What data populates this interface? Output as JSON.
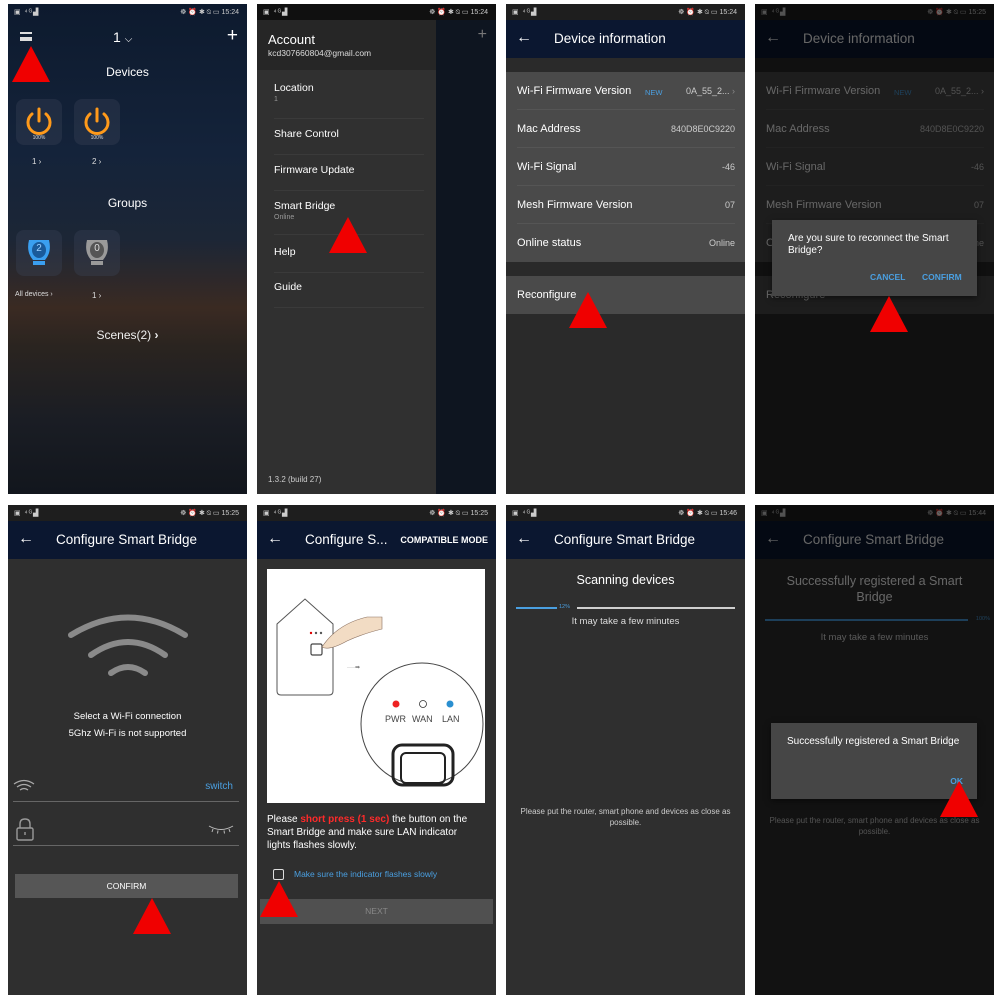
{
  "status_bar": {
    "left_icons": "▣ ⁴ᴳ▟",
    "right_icons": "☸ ⏰ ✱ ⍉ ▭",
    "times": [
      "15:24",
      "15:24",
      "15:24",
      "15:25",
      "15:25",
      "15:25",
      "15:46",
      "15:44"
    ]
  },
  "screen1": {
    "location_selector": "1",
    "devices_heading": "Devices",
    "devices": [
      {
        "label": "1",
        "brightness": "100%"
      },
      {
        "label": "2",
        "brightness": "100%"
      }
    ],
    "groups_heading": "Groups",
    "groups": [
      {
        "label": "All devices",
        "count": "2"
      },
      {
        "label": "1",
        "count": "0"
      }
    ],
    "scenes_link": "Scenes(2)"
  },
  "screen2": {
    "account_title": "Account",
    "account_email": "kcd307660804@gmail.com",
    "menu": [
      {
        "label": "Location",
        "sub": "1"
      },
      {
        "label": "Share Control",
        "sub": ""
      },
      {
        "label": "Firmware Update",
        "sub": ""
      },
      {
        "label": "Smart Bridge",
        "sub": "Online"
      },
      {
        "label": "Help",
        "sub": ""
      },
      {
        "label": "Guide",
        "sub": ""
      }
    ],
    "version": "1.3.2 (build 27)"
  },
  "device_info": {
    "title": "Device information",
    "rows": [
      {
        "key": "Wi-Fi Firmware Version",
        "badge": "NEW",
        "value": "0A_55_2..."
      },
      {
        "key": "Mac Address",
        "value": "840D8E0C9220"
      },
      {
        "key": "Wi-Fi Signal",
        "value": "-46"
      },
      {
        "key": "Mesh Firmware Version",
        "value": "07"
      },
      {
        "key": "Online status",
        "value": "Online"
      }
    ],
    "reconfigure": "Reconfigure"
  },
  "reconnect_dialog": {
    "message": "Are you sure to reconnect the Smart Bridge?",
    "cancel": "CANCEL",
    "confirm": "CONFIRM"
  },
  "configure": {
    "title": "Configure Smart Bridge",
    "title_truncated": "Configure S...",
    "compatible_mode": "COMPATIBLE MODE",
    "select_wifi": "Select a Wi-Fi connection",
    "no_5ghz": "5Ghz Wi-Fi is not supported",
    "switch_link": "switch",
    "confirm_button": "CONFIRM",
    "led_labels": [
      "PWR",
      "WAN",
      "LAN"
    ],
    "instruction_pre": "Please ",
    "instruction_highlight": "short press (1 sec)",
    "instruction_post": " the button on the Smart Bridge and make sure LAN indicator lights flashes slowly.",
    "checkbox_label": "Make sure the indicator flashes slowly",
    "checkbox_checked": false,
    "next_button": "NEXT"
  },
  "scanning": {
    "heading": "Scanning devices",
    "progress_percent": 12,
    "progress_label": "12%",
    "note": "It may take a few minutes",
    "footer": "Please put the router, smart phone and devices as close as possible."
  },
  "success": {
    "heading": "Successfully registered a Smart Bridge",
    "progress_percent": 100,
    "progress_label": "100%",
    "note": "It may take a few minutes",
    "footer": "Please put the router, smart phone and devices as close as possible.",
    "dialog_message": "Successfully registered a Smart Bridge",
    "ok": "OK"
  },
  "colors": {
    "accent_blue": "#4a9fe0",
    "power_orange": "#ff9a1a",
    "arrow_red": "#f00000",
    "appbar_navy": "#0b1730",
    "highlight_red": "#ff2a2a"
  }
}
